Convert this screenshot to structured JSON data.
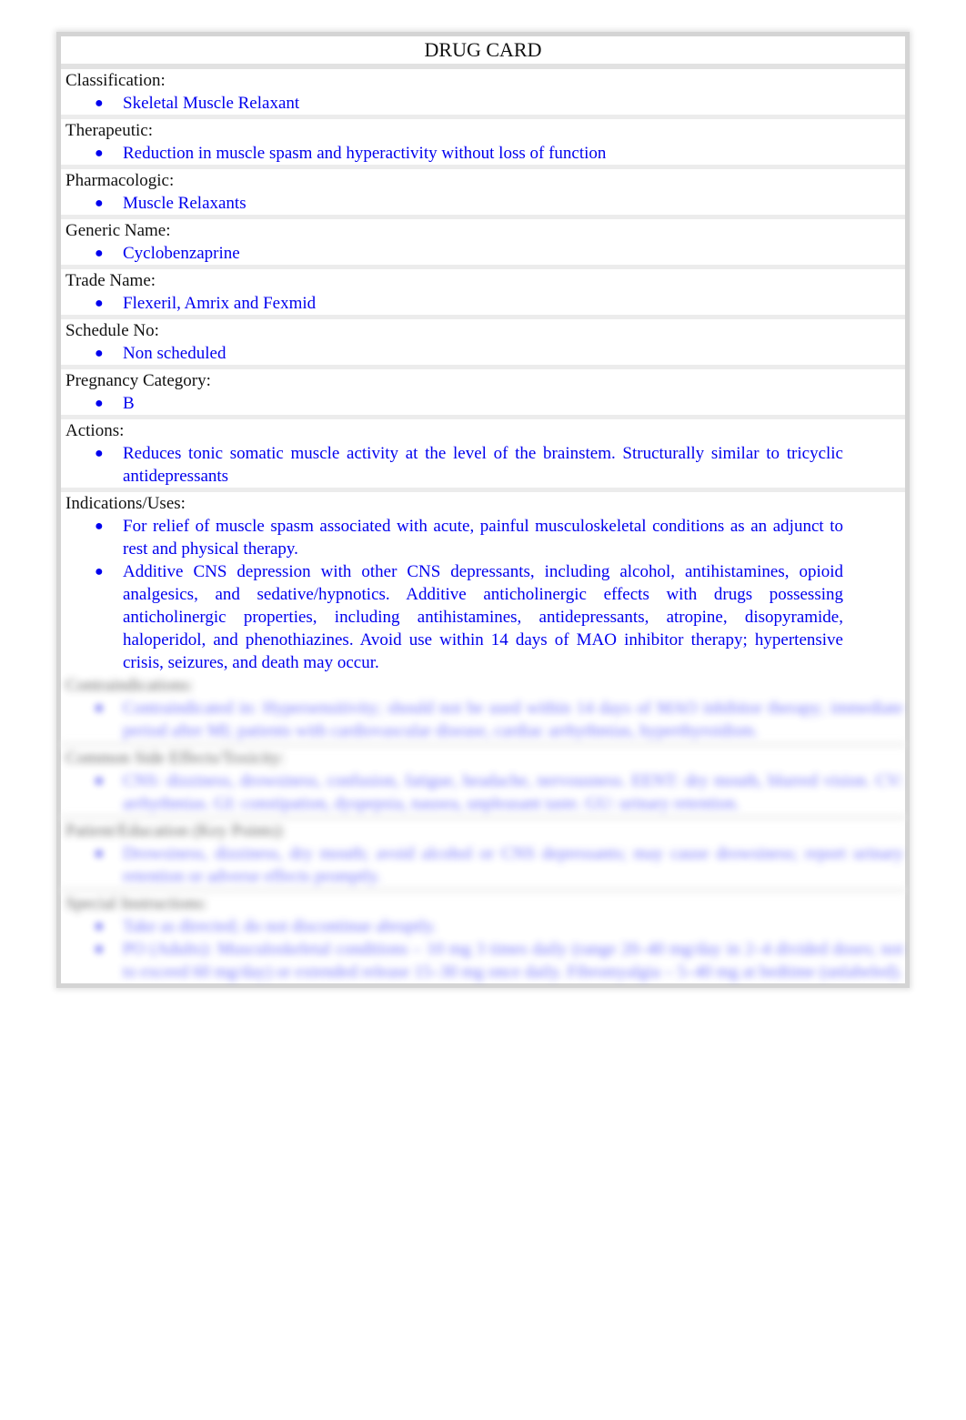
{
  "title": "DRUG CARD",
  "sections": [
    {
      "label": "Classification:",
      "items": [
        "Skeletal Muscle Relaxant"
      ]
    },
    {
      "label": "Therapeutic:",
      "items": [
        "Reduction in muscle spasm and hyperactivity without loss of function"
      ]
    },
    {
      "label": "Pharmacologic:",
      "items": [
        "Muscle Relaxants"
      ]
    },
    {
      "label": "Generic Name:",
      "items": [
        "Cyclobenzaprine"
      ]
    },
    {
      "label": "Trade Name:",
      "items": [
        "Flexeril, Amrix and Fexmid"
      ]
    },
    {
      "label": "Schedule No:",
      "items": [
        "Non scheduled"
      ]
    },
    {
      "label": "Pregnancy Category:",
      "items": [
        "B"
      ]
    },
    {
      "label": "Actions:",
      "items": [
        "Reduces tonic somatic muscle activity at the level of the brainstem. Structurally similar to tricyclic antidepressants"
      ]
    },
    {
      "label": "Indications/Uses:",
      "items": [
        "For relief of muscle spasm associated with acute, painful musculoskeletal conditions as an adjunct to rest and physical therapy.",
        "Additive CNS depression with other CNS depressants, including alcohol, antihistamines, opioid analgesics, and sedative/hypnotics. Additive anticholinergic effects with drugs possessing anticholinergic properties, including antihistamines, antidepressants, atropine, disopyramide, haloperidol, and phenothiazines. Avoid use within 14 days of MAO inhibitor therapy; hypertensive crisis, seizures, and death may occur."
      ]
    }
  ],
  "blurred_sections": [
    {
      "label": "Contraindications:",
      "items": [
        "Contraindicated in: Hypersensitivity; should not be used within 14 days of MAO inhibitor therapy; immediate period after MI; patients with cardiovascular disease, cardiac arrhythmias, hyperthyroidism."
      ]
    },
    {
      "label": "Common Side Effects/Toxicity:",
      "items": [
        "CNS: dizziness, drowsiness, confusion, fatigue, headache, nervousness. EENT: dry mouth, blurred vision. CV: arrhythmias. GI: constipation, dyspepsia, nausea, unpleasant taste. GU: urinary retention."
      ]
    },
    {
      "label": "Patient/Education (Key Points):",
      "items": [
        "Drowsiness, dizziness, dry mouth; avoid alcohol or CNS depressants; may cause drowsiness; report urinary retention or adverse effects promptly."
      ]
    },
    {
      "label": "Special Instructions:",
      "items": [
        "Take as directed; do not discontinue abruptly.",
        "PO (Adults): Musculoskeletal conditions – 10 mg 3 times daily (range 20–40 mg/day in 2–4 divided doses; not to exceed 60 mg/day) or extended release 15–30 mg once daily. Fibromyalgia – 5–40 mg at bedtime (unlabeled)."
      ]
    }
  ]
}
